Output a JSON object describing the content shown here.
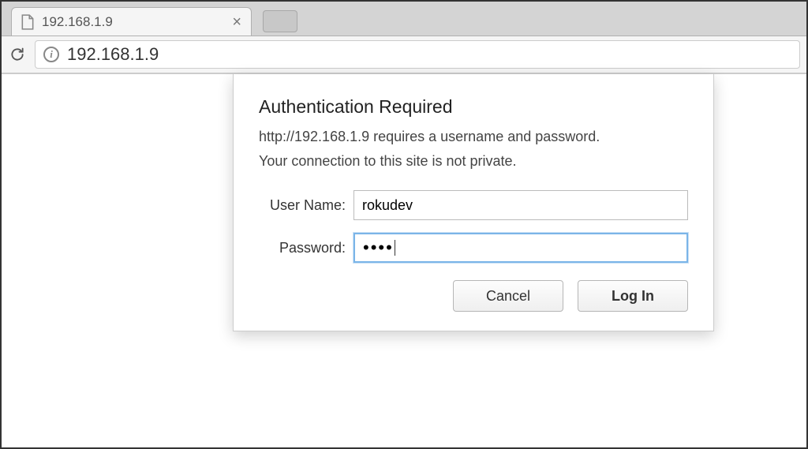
{
  "tab": {
    "title": "192.168.1.9"
  },
  "address_bar": {
    "url": "192.168.1.9"
  },
  "dialog": {
    "title": "Authentication Required",
    "message": "http://192.168.1.9 requires a username and password.",
    "warning": "Your connection to this site is not private.",
    "username_label": "User Name:",
    "password_label": "Password:",
    "username_value": "rokudev",
    "password_mask": "••••",
    "cancel_label": "Cancel",
    "login_label": "Log In"
  }
}
